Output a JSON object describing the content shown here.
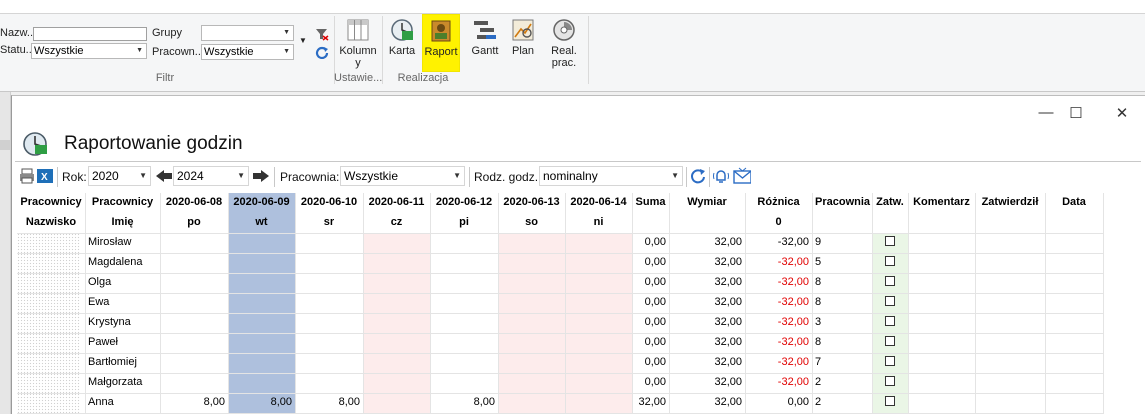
{
  "ribbon": {
    "filter": {
      "name_label": "Nazw...",
      "name_value": "",
      "status_label": "Statu...",
      "status_value": "Wszystkie",
      "groups_label": "Grupy",
      "groups_value": "",
      "worker_label": "Pracown...",
      "worker_value": "Wszystkie",
      "group_title": "Filtr"
    },
    "settings": {
      "columns_label": "Kolumny",
      "group_title": "Ustawie..."
    },
    "realization": {
      "group_title": "Realizacja",
      "buttons": [
        "Karta",
        "Raport",
        "Gantt",
        "Plan",
        "Real. prac."
      ],
      "highlight_color": "#fff200"
    }
  },
  "window": {
    "title": "Raportowanie godzin",
    "controls": [
      "minimize",
      "maximize",
      "close"
    ]
  },
  "toolbar": {
    "year_label": "Rok:",
    "year_value": "2020",
    "year2_value": "2024",
    "workshop_label": "Pracownia:",
    "workshop_value": "Wszystkie",
    "hours_type_label": "Rodz. godz.:",
    "hours_type_value": "nominalny"
  },
  "grid": {
    "header1": [
      "Pracownicy",
      "Pracownicy",
      "2020-06-08",
      "2020-06-09",
      "2020-06-10",
      "2020-06-11",
      "2020-06-12",
      "2020-06-13",
      "2020-06-14",
      "Suma",
      "Wymiar",
      "Różnica",
      "Pracownia",
      "Zatw.",
      "Komentarz",
      "Zatwierdził",
      "Data"
    ],
    "header2": [
      "Nazwisko",
      "Imię",
      "po",
      "wt",
      "sr",
      "cz",
      "pi",
      "so",
      "ni",
      "",
      "",
      "0",
      "",
      "",
      "",
      "",
      ""
    ],
    "rows": [
      {
        "imie": "Mirosław",
        "days": [
          "",
          "",
          "",
          "",
          "",
          "",
          ""
        ],
        "suma": "0,00",
        "wymiar": "32,00",
        "roznica": "-32,00",
        "neg": false,
        "pracownia": "9"
      },
      {
        "imie": "Magdalena",
        "days": [
          "",
          "",
          "",
          "",
          "",
          "",
          ""
        ],
        "suma": "0,00",
        "wymiar": "32,00",
        "roznica": "-32,00",
        "neg": true,
        "pracownia": "5"
      },
      {
        "imie": "Olga",
        "days": [
          "",
          "",
          "",
          "",
          "",
          "",
          ""
        ],
        "suma": "0,00",
        "wymiar": "32,00",
        "roznica": "-32,00",
        "neg": true,
        "pracownia": "8"
      },
      {
        "imie": "Ewa",
        "days": [
          "",
          "",
          "",
          "",
          "",
          "",
          ""
        ],
        "suma": "0,00",
        "wymiar": "32,00",
        "roznica": "-32,00",
        "neg": true,
        "pracownia": "8"
      },
      {
        "imie": "Krystyna",
        "days": [
          "",
          "",
          "",
          "",
          "",
          "",
          ""
        ],
        "suma": "0,00",
        "wymiar": "32,00",
        "roznica": "-32,00",
        "neg": true,
        "pracownia": "3"
      },
      {
        "imie": "Paweł",
        "days": [
          "",
          "",
          "",
          "",
          "",
          "",
          ""
        ],
        "suma": "0,00",
        "wymiar": "32,00",
        "roznica": "-32,00",
        "neg": true,
        "pracownia": "8"
      },
      {
        "imie": "Bartłomiej",
        "days": [
          "",
          "",
          "",
          "",
          "",
          "",
          ""
        ],
        "suma": "0,00",
        "wymiar": "32,00",
        "roznica": "-32,00",
        "neg": true,
        "pracownia": "7"
      },
      {
        "imie": "Małgorzata",
        "days": [
          "",
          "",
          "",
          "",
          "",
          "",
          ""
        ],
        "suma": "0,00",
        "wymiar": "32,00",
        "roznica": "-32,00",
        "neg": true,
        "pracownia": "2"
      },
      {
        "imie": "Anna",
        "days": [
          "8,00",
          "8,00",
          "8,00",
          "",
          "8,00",
          "",
          ""
        ],
        "suma": "32,00",
        "wymiar": "32,00",
        "roznica": "0,00",
        "neg": false,
        "pracownia": "2"
      }
    ]
  },
  "colors": {
    "selected_column": "#aec0dd",
    "weekend_column": "#fdecec",
    "approve_column": "#eaf6e6",
    "negative": "#e10000"
  }
}
